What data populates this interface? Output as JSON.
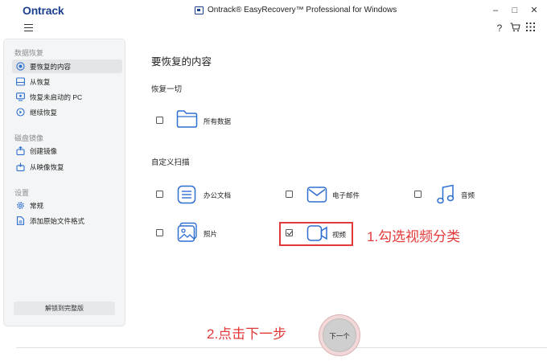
{
  "titlebar": {
    "brand": "Ontrack",
    "title": "Ontrack® EasyRecovery™ Professional for Windows",
    "minimize": "–",
    "maximize": "□",
    "close": "✕"
  },
  "toolbar": {
    "help": "?",
    "cart": "🛒",
    "apps": "⋮⋮⋮"
  },
  "sidebar": {
    "sections": [
      {
        "title": "数据恢复",
        "items": [
          {
            "label": "要恢复的内容",
            "icon": "target-icon",
            "active": true
          },
          {
            "label": "从恢复",
            "icon": "drive-icon",
            "active": false
          },
          {
            "label": "恢复未启动的 PC",
            "icon": "monitor-icon",
            "active": false
          },
          {
            "label": "继续恢复",
            "icon": "resume-icon",
            "active": false
          }
        ]
      },
      {
        "title": "磁盘镜像",
        "items": [
          {
            "label": "创建镜像",
            "icon": "create-image-icon",
            "active": false
          },
          {
            "label": "从映像恢复",
            "icon": "restore-image-icon",
            "active": false
          }
        ]
      },
      {
        "title": "设置",
        "items": [
          {
            "label": "常规",
            "icon": "gear-icon",
            "active": false
          },
          {
            "label": "添加原始文件格式",
            "icon": "add-file-icon",
            "active": false
          }
        ]
      }
    ],
    "unlock_label": "解锁到完整版"
  },
  "main": {
    "title": "要恢复的内容",
    "recover_all": {
      "heading": "恢复一切",
      "item": {
        "label": "所有数据",
        "icon": "folder-icon",
        "checked": false
      }
    },
    "custom_scan": {
      "heading": "自定义扫描",
      "items": [
        {
          "label": "办公文档",
          "icon": "document-icon",
          "checked": false
        },
        {
          "label": "电子邮件",
          "icon": "mail-icon",
          "checked": false
        },
        {
          "label": "音频",
          "icon": "music-icon",
          "checked": false
        },
        {
          "label": "照片",
          "icon": "photo-icon",
          "checked": false
        },
        {
          "label": "视频",
          "icon": "video-icon",
          "checked": true
        }
      ]
    },
    "next_label": "下一个"
  },
  "annotations": {
    "step1": "1.勾选视频分类",
    "step2": "2.点击下一步"
  },
  "colors": {
    "brand": "#1d3f8f",
    "annotation_red": "#e23a3a",
    "icon_blue": "#2e6fd0"
  }
}
